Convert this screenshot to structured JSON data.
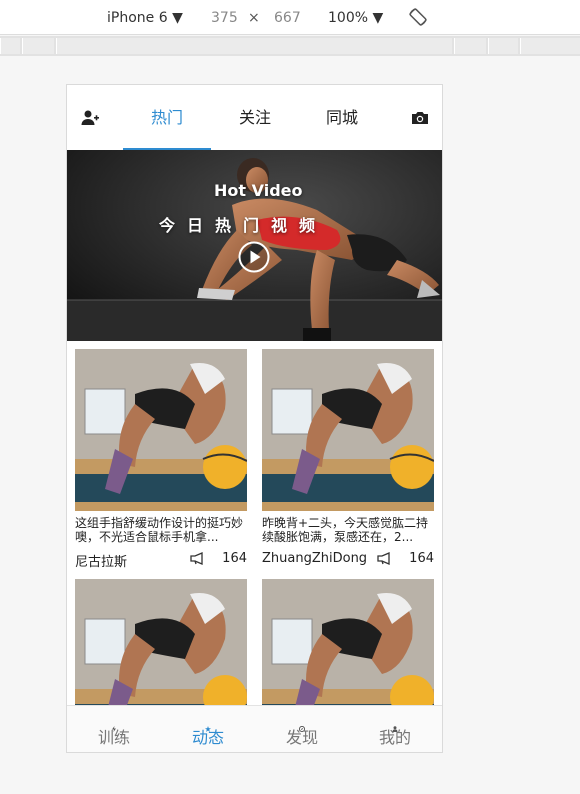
{
  "devtools": {
    "device": "iPhone 6 ▼",
    "width": "375",
    "times": "×",
    "height": "667",
    "zoom": "100% ▼"
  },
  "top_nav": {
    "tabs": [
      {
        "label": "热门"
      },
      {
        "label": "关注"
      },
      {
        "label": "同城"
      }
    ]
  },
  "hero": {
    "title": "Hot Video",
    "subtitle": "今日热门视频"
  },
  "feed": [
    {
      "desc": "这组手指舒缓动作设计的挺巧妙噢，不光适合鼠标手机拿...",
      "author": "尼古拉斯",
      "count": "164"
    },
    {
      "desc": "昨晚背+二头，今天感觉肱二持续酸胀饱满，泵感还在，2...",
      "author": "ZhuangZhiDong",
      "count": "164"
    },
    {
      "desc": "",
      "author": "",
      "count": ""
    },
    {
      "desc": "",
      "author": "",
      "count": ""
    }
  ],
  "bottom_nav": {
    "items": [
      {
        "label": "训练"
      },
      {
        "label": "动态"
      },
      {
        "label": "发现"
      },
      {
        "label": "我的"
      }
    ]
  },
  "colors": {
    "accent": "#2e8bd0",
    "text": "#222222",
    "muted": "#777777"
  }
}
